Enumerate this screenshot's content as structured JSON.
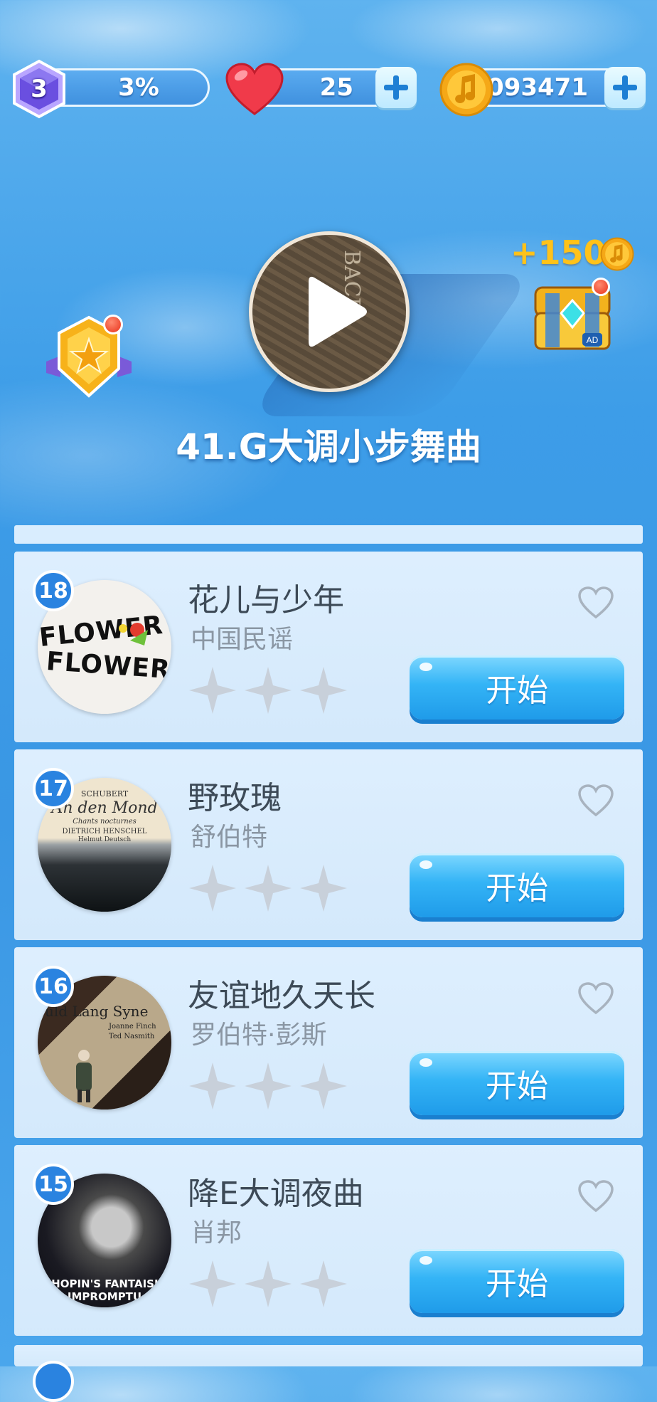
{
  "hud": {
    "level": "3",
    "progress": "3%",
    "lives": "25",
    "coins": "7093471"
  },
  "hero": {
    "current_song": "41.G大调小步舞曲",
    "cover_text": "BACH",
    "reward": "+150"
  },
  "songs": [
    {
      "number": "18",
      "title": "花儿与少年",
      "artist": "中国民谣",
      "start_label": "开始",
      "cover_lines": [
        "FLOWER",
        "FLOWER"
      ],
      "stars": 0
    },
    {
      "number": "17",
      "title": "野玫瑰",
      "artist": "舒伯特",
      "start_label": "开始",
      "cover_lines": [
        "SCHUBERT",
        "An den Mond",
        "Chants nocturnes",
        "DIETRICH HENSCHEL",
        "Helmut Deutsch"
      ],
      "stars": 0
    },
    {
      "number": "16",
      "title": "友谊地久天长",
      "artist": "罗伯特·彭斯",
      "start_label": "开始",
      "cover_lines": [
        "uld Lang Syne",
        "Joanne Finch",
        "Ted Nasmith"
      ],
      "stars": 0
    },
    {
      "number": "15",
      "title": "降E大调夜曲",
      "artist": "肖邦",
      "start_label": "开始",
      "cover_lines": [
        "CHOPIN'S FANTAISIE",
        "IMPROMPTU"
      ],
      "stars": 0
    }
  ],
  "colors": {
    "sky": "#3d9de8",
    "accent_blue": "#1f9be9",
    "gold": "#ffc21a",
    "badge_blue": "#2a83e0"
  }
}
